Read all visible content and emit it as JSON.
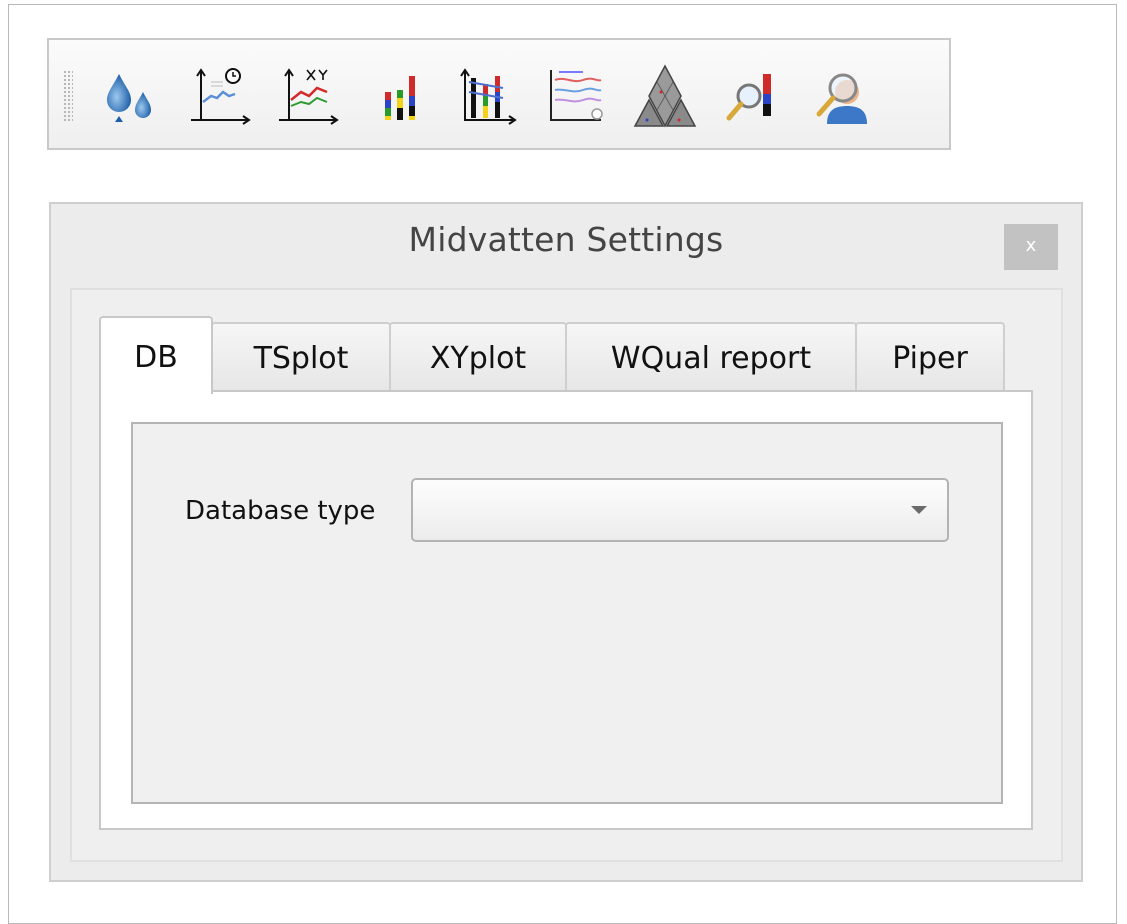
{
  "toolbar": {
    "buttons": [
      {
        "name": "load-data-icon"
      },
      {
        "name": "time-series-plot-icon"
      },
      {
        "name": "xy-plot-icon"
      },
      {
        "name": "stratigraphy-plot-icon"
      },
      {
        "name": "section-plot-icon"
      },
      {
        "name": "water-quality-report-icon"
      },
      {
        "name": "piper-diagram-icon"
      },
      {
        "name": "search-stratigraphy-icon"
      },
      {
        "name": "search-user-icon"
      }
    ]
  },
  "dialog": {
    "title": "Midvatten Settings",
    "close_label": "x",
    "tabs": [
      {
        "label": "DB"
      },
      {
        "label": "TSplot"
      },
      {
        "label": "XYplot"
      },
      {
        "label": "WQual report"
      },
      {
        "label": "Piper"
      }
    ],
    "active_tab": "DB",
    "db": {
      "database_type_label": "Database type",
      "database_type_value": ""
    }
  }
}
